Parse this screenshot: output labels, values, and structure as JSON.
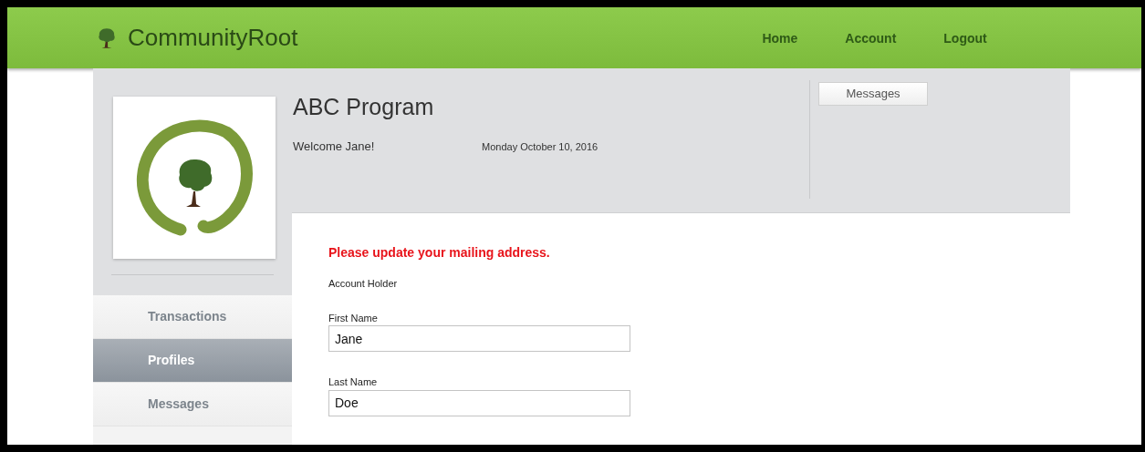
{
  "header": {
    "brand": "CommunityRoot",
    "nav": [
      {
        "label": "Home"
      },
      {
        "label": "Account"
      },
      {
        "label": "Logout"
      }
    ]
  },
  "program": {
    "title": "ABC Program",
    "welcome": "Welcome Jane!",
    "date": "Monday October 10, 2016"
  },
  "messages_button": "Messages",
  "sidebar": {
    "items": [
      {
        "label": "Transactions",
        "selected": false
      },
      {
        "label": "Profiles",
        "selected": true
      },
      {
        "label": "Messages",
        "selected": false
      }
    ]
  },
  "form": {
    "notice": "Please update your mailing address.",
    "section": "Account Holder",
    "fields": [
      {
        "label": "First Name",
        "value": "Jane"
      },
      {
        "label": "Last Name",
        "value": "Doe"
      }
    ]
  }
}
